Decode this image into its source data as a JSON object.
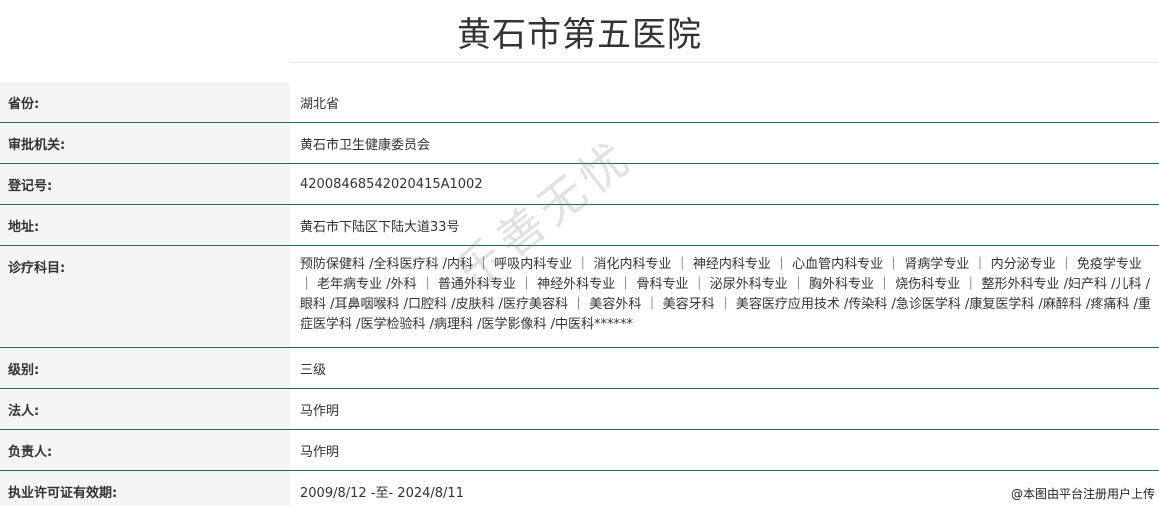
{
  "header": {
    "title": "黄石市第五医院"
  },
  "fields": {
    "province": {
      "label": "省份:",
      "value": "湖北省"
    },
    "authority": {
      "label": "审批机关:",
      "value": "黄石市卫生健康委员会"
    },
    "registration": {
      "label": "登记号:",
      "value": "42008468542020415A1002"
    },
    "address": {
      "label": "地址:",
      "value": "黄石市下陆区下陆大道33号"
    },
    "departments": {
      "label": "诊疗科目:",
      "value": "预防保健科 /全科医疗科 /内科 ｜ 呼吸内科专业 ｜ 消化内科专业 ｜ 神经内科专业 ｜ 心血管内科专业 ｜ 肾病学专业 ｜ 内分泌专业 ｜ 免疫学专业 ｜ 老年病专业 /外科 ｜ 普通外科专业 ｜ 神经外科专业 ｜ 骨科专业 ｜ 泌尿外科专业 ｜ 胸外科专业 ｜ 烧伤科专业 ｜ 整形外科专业 /妇产科 /儿科 /眼科 /耳鼻咽喉科 /口腔科 /皮肤科 /医疗美容科 ｜ 美容外科 ｜ 美容牙科 ｜ 美容医疗应用技术 /传染科 /急诊医学科 /康复医学科 /麻醉科 /疼痛科 /重症医学科 /医学检验科 /病理科 /医学影像科 /中医科******"
    },
    "level": {
      "label": "级别:",
      "value": "三级"
    },
    "legal_person": {
      "label": "法人:",
      "value": "马作明"
    },
    "person_in_charge": {
      "label": "负责人:",
      "value": "马作明"
    },
    "license_validity": {
      "label": "执业许可证有效期:",
      "value": "2009/8/12 -至- 2024/8/11"
    }
  },
  "watermark": "乐善无忧",
  "upload_note": "@本图由平台注册用户上传"
}
